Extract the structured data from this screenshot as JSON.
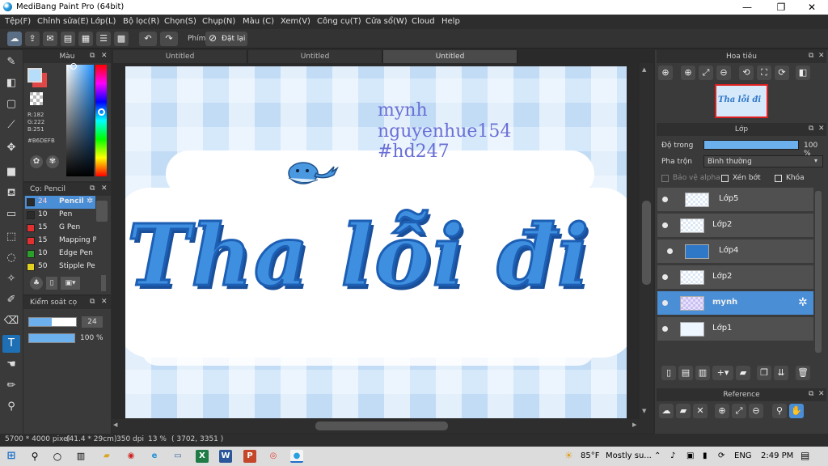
{
  "window": {
    "title": "MediBang Paint Pro (64bit)"
  },
  "menu": [
    "Tệp(F)",
    "Chỉnh sửa(E)",
    "Lớp(L)",
    "Bộ lọc(R)",
    "Chọn(S)",
    "Chụp(N)",
    "Màu (C)",
    "Xem(V)",
    "Công cụ(T)",
    "Cửa sổ(W)",
    "Cloud",
    "Help"
  ],
  "toolbar": {
    "keys_label": "Phím",
    "reset_label": "Đặt lại"
  },
  "color_panel": {
    "title": "Màu",
    "rgb": [
      "R:182",
      "G:222",
      "B:251"
    ],
    "hex": "#B6DEFB",
    "primary_color": "#b6defb",
    "secondary_color": "#e04848"
  },
  "brush_panel": {
    "title": "Cọ: Pencil",
    "brushes": [
      {
        "size": "24",
        "name": "Pencil",
        "color": "#2b2b2b"
      },
      {
        "size": "10",
        "name": "Pen",
        "color": "#2b2b2b"
      },
      {
        "size": "15",
        "name": "G Pen",
        "color": "#e03030"
      },
      {
        "size": "15",
        "name": "Mapping P",
        "color": "#e03030"
      },
      {
        "size": "10",
        "name": "Edge Pen",
        "color": "#2aa02a"
      },
      {
        "size": "50",
        "name": "Stipple Pe",
        "color": "#e0d020"
      }
    ]
  },
  "brush_control": {
    "title": "Kiểm soát cọ",
    "size": "24",
    "opacity": "100 %"
  },
  "tabs": [
    "Untitled",
    "Untitled",
    "Untitled"
  ],
  "canvas": {
    "watermark": [
      "mynh",
      "nguyenhue154",
      "#hd247"
    ],
    "art_text": "Tha lỗi đi"
  },
  "navigator": {
    "title": "Hoa tiêu",
    "thumb_text": "Tha lỗi đi"
  },
  "layer_panel": {
    "title": "Lớp",
    "opacity_label": "Độ trong",
    "opacity_value": "100 %",
    "opacity_fraction": 1.0,
    "blend_label": "Pha trộn",
    "blend_value": "Bình thường",
    "protect_alpha": "Bảo vệ alpha",
    "clipping": "Xén bớt",
    "lock": "Khóa",
    "layers": [
      {
        "name": "Lớp5",
        "selected": false
      },
      {
        "name": "Lớp2",
        "selected": false
      },
      {
        "name": "Lớp4",
        "selected": false
      },
      {
        "name": "Lớp2",
        "selected": false
      },
      {
        "name": "mynh",
        "selected": true
      },
      {
        "name": "Lớp1",
        "selected": false
      }
    ]
  },
  "reference": {
    "title": "Reference"
  },
  "status": {
    "size": "5700 * 4000 pixel",
    "cm": "(41.4 * 29cm)",
    "dpi": "350 dpi",
    "zoom": "13 %",
    "coords": "( 3702, 3351 )"
  },
  "taskbar": {
    "weather_temp": "85°F",
    "weather_text": "Mostly su...",
    "lang": "ENG",
    "time": "2:49 PM"
  },
  "colors": {
    "accent": "#4a8ed6",
    "panel": "#3a3a3a"
  }
}
